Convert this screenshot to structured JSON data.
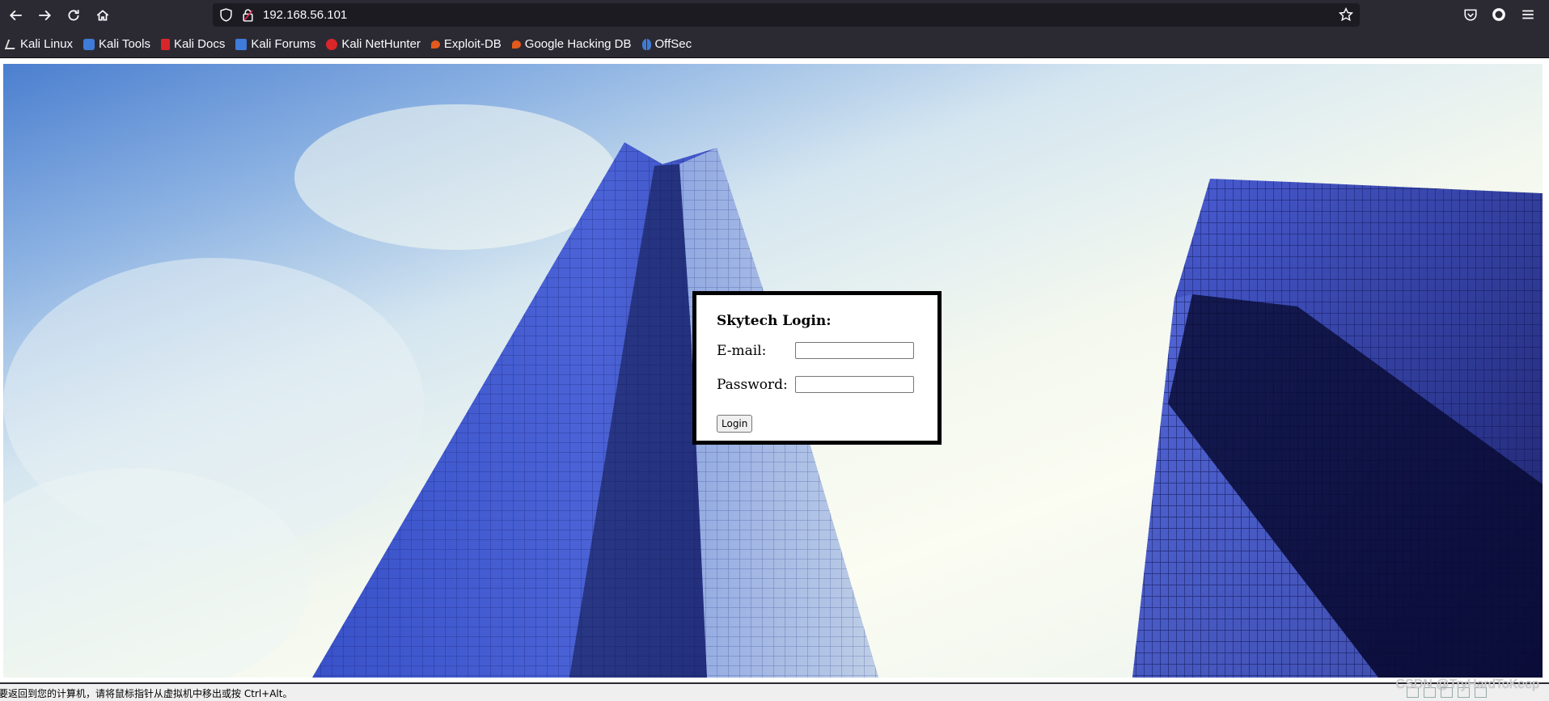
{
  "browser": {
    "url": "192.168.56.101",
    "bookmarks": [
      {
        "label": "Kali Linux",
        "color": "#e6e6e6"
      },
      {
        "label": "Kali Tools",
        "color": "#3f7bd8"
      },
      {
        "label": "Kali Docs",
        "color": "#d8262b"
      },
      {
        "label": "Kali Forums",
        "color": "#3f7bd8"
      },
      {
        "label": "Kali NetHunter",
        "color": "#d8262b"
      },
      {
        "label": "Exploit-DB",
        "color": "#e25a1c"
      },
      {
        "label": "Google Hacking DB",
        "color": "#e25a1c"
      },
      {
        "label": "OffSec",
        "color": "#3f7bd8"
      }
    ]
  },
  "login": {
    "title": "Skytech Login:",
    "email_label": "E-mail:",
    "password_label": "Password:",
    "email_value": "",
    "password_value": "",
    "button_label": "Login"
  },
  "statusbar": {
    "message": "要返回到您的计算机，请将鼠标指针从虚拟机中移出或按 Ctrl+Alt。",
    "watermark": "CSDN @TryHardToKeep"
  },
  "icons": {
    "back": "arrow-left-icon",
    "forward": "arrow-right-icon",
    "reload": "reload-icon",
    "home": "home-icon",
    "shield": "shield-icon",
    "lock": "lock-icon",
    "star": "star-icon",
    "pocket": "pocket-icon",
    "account": "account-icon",
    "menu": "hamburger-menu-icon"
  },
  "colors": {
    "toolbar_bg": "#2b2a33",
    "urlbar_bg": "#1c1b22",
    "login_border": "#000000",
    "building": "#2a3fae"
  }
}
